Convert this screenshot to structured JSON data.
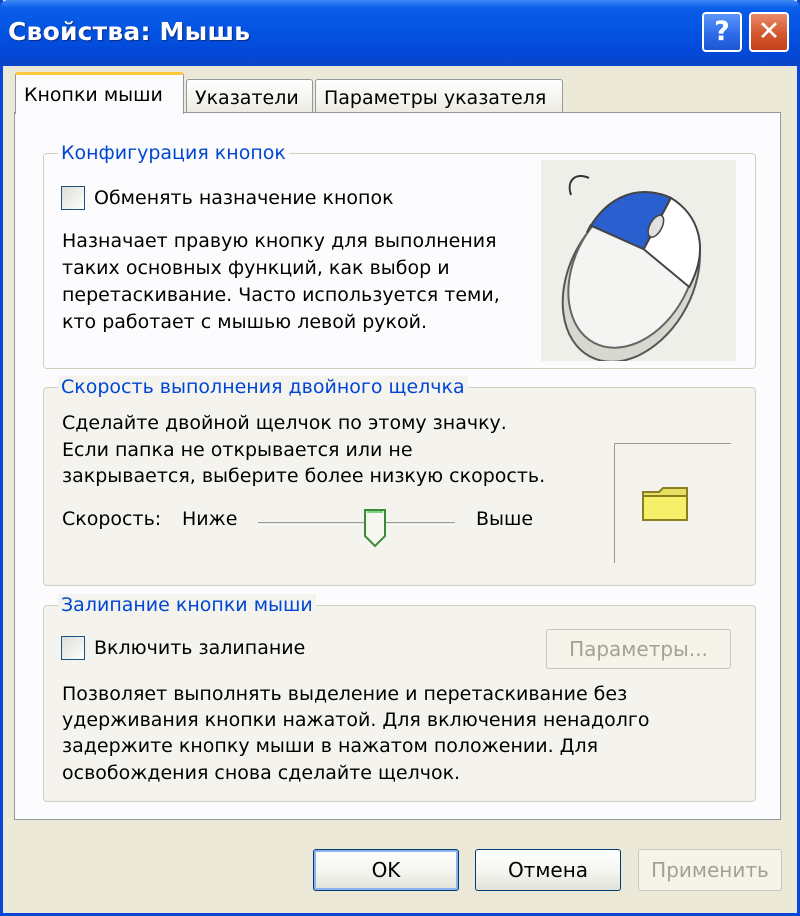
{
  "window": {
    "title": "Свойства: Мышь"
  },
  "titlebar_buttons": {
    "help": "?",
    "close": "✕"
  },
  "tabs": [
    {
      "label": "Кнопки мыши",
      "active": true
    },
    {
      "label": "Указатели",
      "active": false
    },
    {
      "label": "Параметры указателя",
      "active": false
    }
  ],
  "button_config": {
    "title": "Конфигурация кнопок",
    "swap_checkbox": {
      "label": "Обменять назначение кнопок",
      "checked": false
    },
    "description": [
      "Назначает правую кнопку для выполнения",
      "таких основных функций, как выбор и",
      "перетаскивание. Часто используется теми,",
      "кто работает с мышью левой рукой."
    ],
    "image_icon": "mouse-icon"
  },
  "double_click": {
    "title": "Скорость выполнения двойного щелчка",
    "description": [
      "Сделайте двойной щелчок по этому значку.",
      "Если папка не открывается или не",
      "закрывается, выберите более низкую скорость."
    ],
    "speed_label": "Скорость:",
    "slow_label": "Ниже",
    "fast_label": "Выше",
    "slider_position": 0.6,
    "test_icon": "folder-icon"
  },
  "click_lock": {
    "title": "Залипание кнопки мыши",
    "checkbox": {
      "label": "Включить залипание",
      "checked": false
    },
    "settings_button": "Параметры...",
    "description": [
      "Позволяет выполнять выделение и перетаскивание без",
      "удерживания кнопки нажатой. Для включения ненадолго",
      "задержите кнопку мыши в нажатом положении. Для",
      "освобождения снова сделайте щелчок."
    ]
  },
  "dialog_buttons": {
    "ok": "OK",
    "cancel": "Отмена",
    "apply": "Применить"
  },
  "colors": {
    "titlebar": "#0454e3",
    "group_title": "#0046d5",
    "mouse_button": "#2a5fd0",
    "folder": "#f4f06a"
  }
}
